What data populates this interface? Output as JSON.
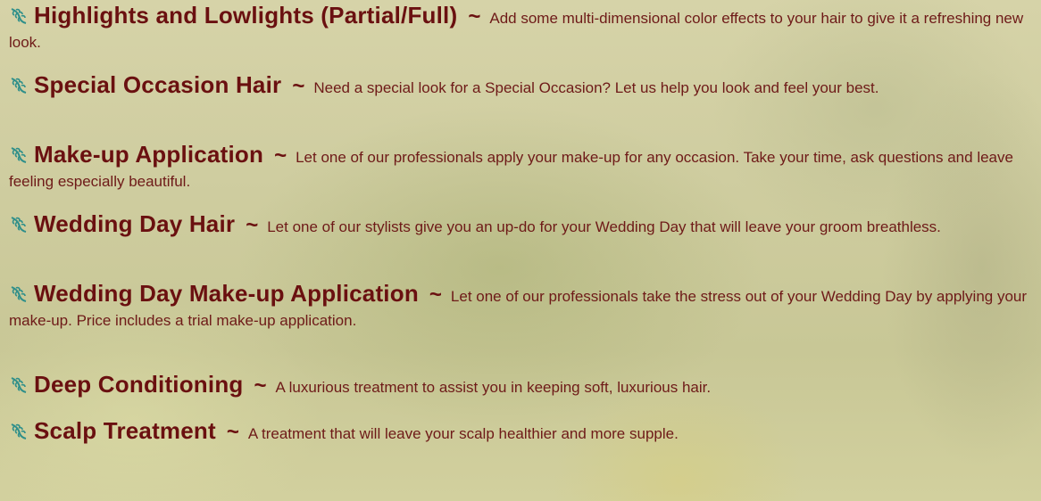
{
  "colors": {
    "heading": "#6a1010",
    "body_text": "#6e1a18",
    "bullet_icon": "#2f8f8a",
    "background": "#cfcda0"
  },
  "services": [
    {
      "icon": "flower-bullet-icon",
      "name": "Highlights and Lowlights (Partial/Full)",
      "separator": "~",
      "description": "Add some multi-dimensional color effects to your hair to give it a refreshing new look."
    },
    {
      "icon": "flower-bullet-icon",
      "name": "Special Occasion Hair",
      "separator": "~",
      "description": "Need a special look for a Special Occasion? Let us help you look and feel your best."
    },
    {
      "icon": "flower-bullet-icon",
      "name": "Make-up Application",
      "separator": "~",
      "description": "Let one of our professionals apply your make-up for any occasion. Take your time, ask questions and leave feeling especially beautiful."
    },
    {
      "icon": "flower-bullet-icon",
      "name": "Wedding Day Hair",
      "separator": "~",
      "description": "Let one of our stylists give you an up-do for your Wedding Day that will leave your groom breathless."
    },
    {
      "icon": "flower-bullet-icon",
      "name": "Wedding Day Make-up Application",
      "separator": "~",
      "description": "Let one of our professionals take the stress out of your Wedding Day by applying your make-up. Price includes a trial make-up application."
    },
    {
      "icon": "flower-bullet-icon",
      "name": "Deep Conditioning",
      "separator": "~",
      "description": "A luxurious treatment to assist you in keeping soft, luxurious hair."
    },
    {
      "icon": "flower-bullet-icon",
      "name": "Scalp Treatment",
      "separator": "~",
      "description": "A treatment that will leave your scalp healthier and more supple."
    }
  ]
}
